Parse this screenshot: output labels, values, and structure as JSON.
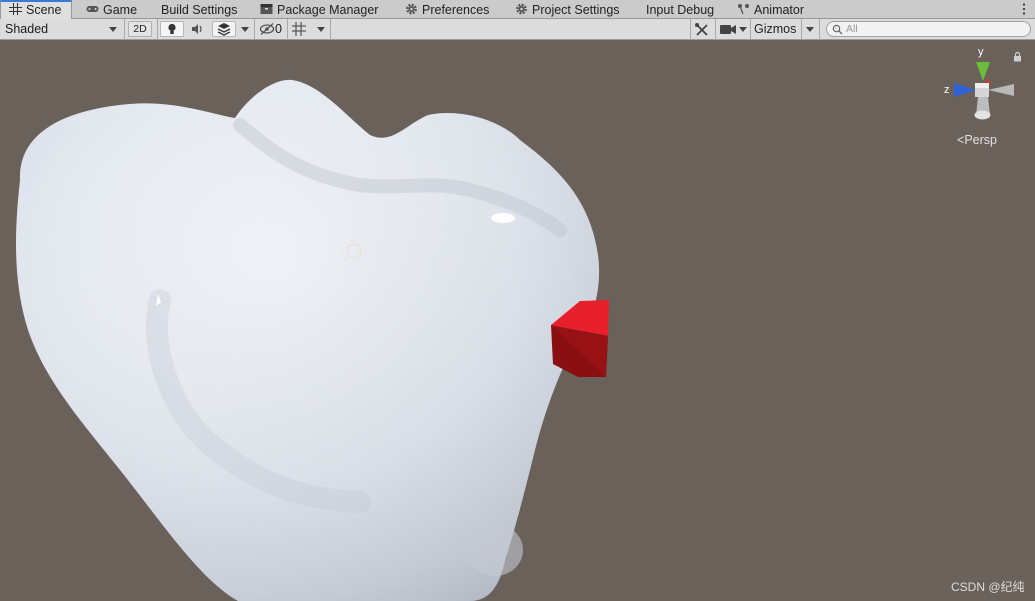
{
  "tabs": [
    {
      "label": "Scene",
      "icon": "grid-icon",
      "active": true
    },
    {
      "label": "Game",
      "icon": "gamepad-icon",
      "active": false
    },
    {
      "label": "Build Settings",
      "icon": "",
      "active": false
    },
    {
      "label": "Package Manager",
      "icon": "package-icon",
      "active": false
    },
    {
      "label": "Preferences",
      "icon": "gear-icon",
      "active": false
    },
    {
      "label": "Project Settings",
      "icon": "gear-icon",
      "active": false
    },
    {
      "label": "Input Debug",
      "icon": "",
      "active": false
    },
    {
      "label": "Animator",
      "icon": "animator-icon",
      "active": false
    }
  ],
  "toolbar": {
    "draw_mode": "Shaded",
    "mode_2d": "2D",
    "hidden_count": "0",
    "gizmos_label": "Gizmos",
    "search_placeholder": "All"
  },
  "viewport": {
    "gizmo": {
      "y_label": "y",
      "z_label": "z"
    },
    "projection": "Persp",
    "projection_icon": "perspective-chevron-icon",
    "background_color": "#6a615b",
    "model_color": "#e6ebf3",
    "cube_color": "#e01a26"
  },
  "watermark": "CSDN @纪纯"
}
